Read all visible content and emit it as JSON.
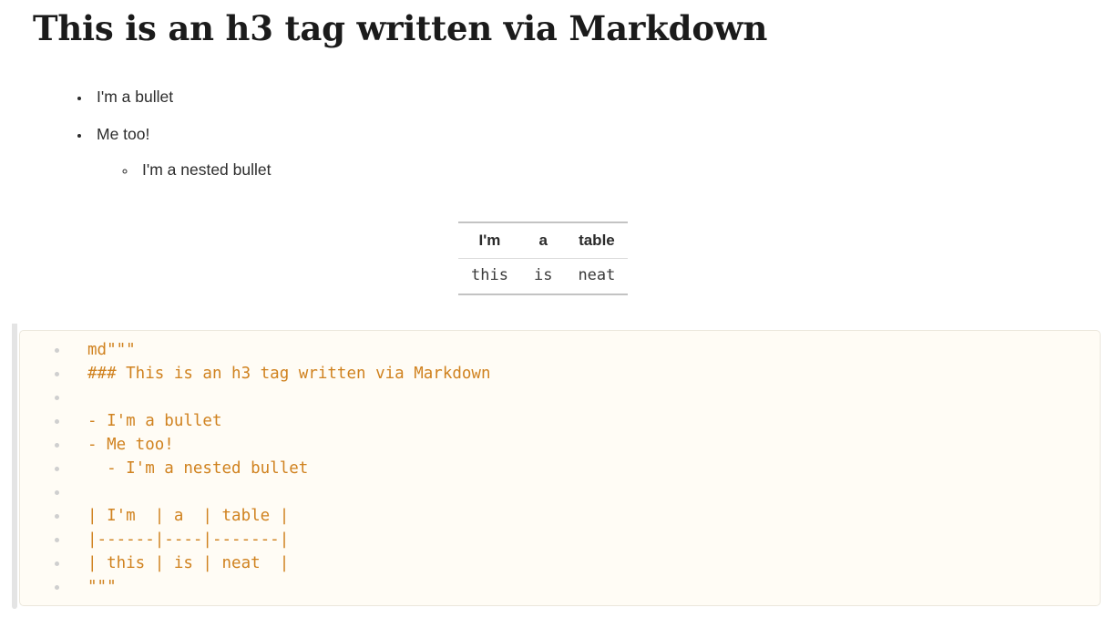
{
  "document": {
    "heading": "This is an h3 tag written via Markdown",
    "bullets": [
      {
        "label": "I'm a bullet",
        "marker": "disc"
      },
      {
        "label": "Me too!",
        "marker": "disc"
      }
    ],
    "nested_bullets": [
      {
        "label": "I'm a nested bullet",
        "marker": "circle"
      }
    ],
    "table": {
      "headers": [
        "I'm",
        "a",
        "table"
      ],
      "rows": [
        [
          "this",
          "is",
          "neat"
        ]
      ]
    }
  },
  "code_cell": {
    "language": "julia-markdown",
    "lines": [
      "md\"\"\"",
      "### This is an h3 tag written via Markdown",
      "",
      "- I'm a bullet",
      "- Me too!",
      "  - I'm a nested bullet",
      "",
      "| I'm  | a  | table |",
      "|------|----|-------|",
      "| this | is | neat  |",
      "\"\"\""
    ]
  },
  "colors": {
    "code_text": "#d0821f",
    "code_background": "#fffcf5",
    "code_border": "#ebe7dc",
    "gutter_dot": "#cfcfcf",
    "cell_bar": "#e4e4e4",
    "heading_text": "#1b1b1b",
    "body_text": "#2c2c2c",
    "table_rule": "#c3c3c3"
  }
}
